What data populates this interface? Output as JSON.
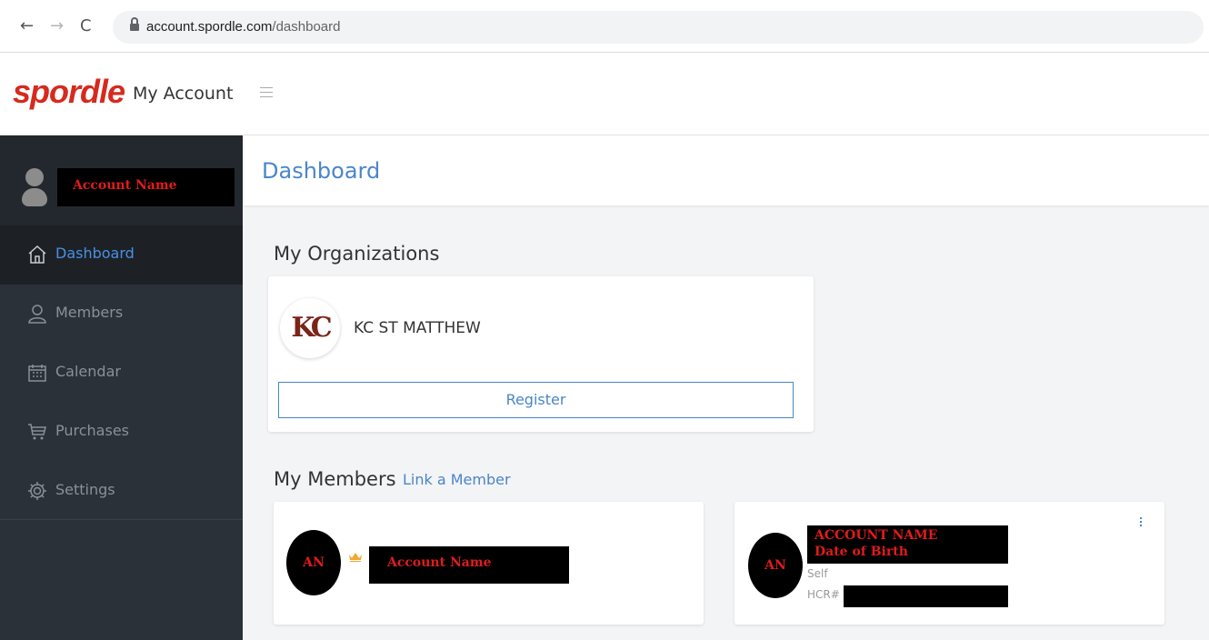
{
  "browser": {
    "url_domain": "account.spordle.com",
    "url_path": "/dashboard",
    "back": "←",
    "forward": "→",
    "reload": "C"
  },
  "header": {
    "logo": "spordle",
    "title": "My Account"
  },
  "sidebar": {
    "user_name": "Account Name",
    "items": [
      {
        "label": "Dashboard",
        "icon": "home-icon",
        "active": true
      },
      {
        "label": "Members",
        "icon": "user-icon",
        "active": false
      },
      {
        "label": "Calendar",
        "icon": "calendar-icon",
        "active": false
      },
      {
        "label": "Purchases",
        "icon": "cart-icon",
        "active": false
      },
      {
        "label": "Settings",
        "icon": "gear-icon",
        "active": false
      }
    ]
  },
  "main": {
    "page_title": "Dashboard",
    "organizations": {
      "title": "My Organizations",
      "items": [
        {
          "logo": "KC",
          "name": "KC ST MATTHEW",
          "register_label": "Register"
        }
      ]
    },
    "members": {
      "title": "My Members",
      "link_label": "Link a Member",
      "items": [
        {
          "initials": "AN",
          "name": "Account Name"
        },
        {
          "initials": "AN",
          "name": "ACCOUNT NAME",
          "dob": "Date of Birth",
          "relation": "Self",
          "hcr_label": "HCR#"
        }
      ]
    }
  },
  "colors": {
    "brand": "#d62a1f",
    "accent": "#4a86c8",
    "sidebar": "#2b3138",
    "redaction": "#000000",
    "redaction_text": "#e11b1b"
  }
}
